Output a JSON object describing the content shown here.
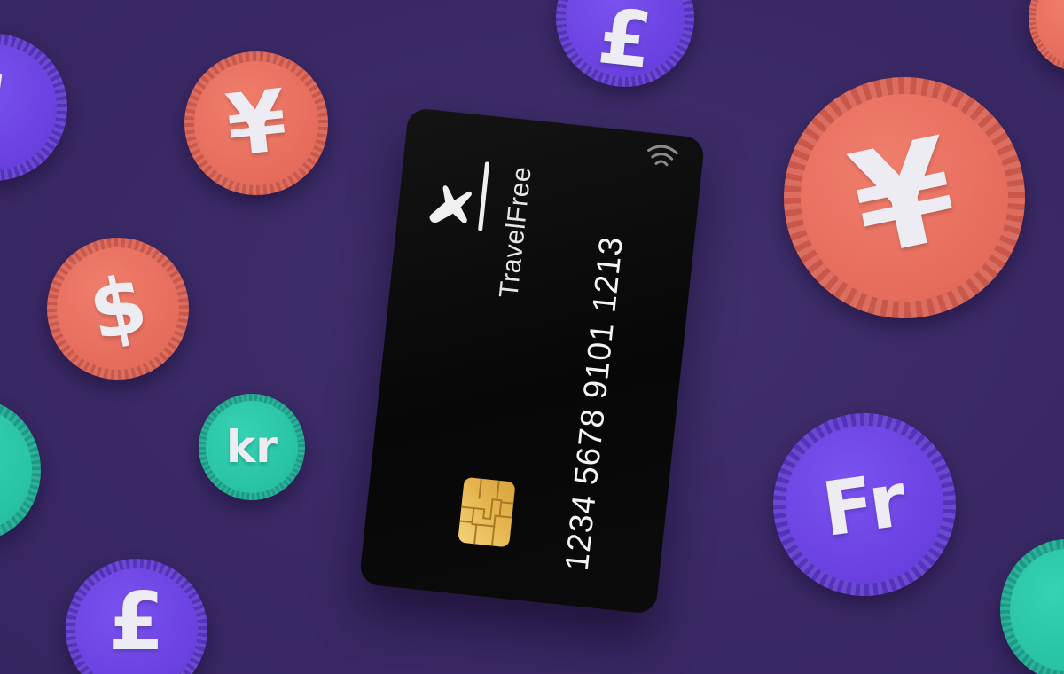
{
  "card": {
    "brand_name": "TravelFree",
    "number": "1234 5678 9101 1213"
  },
  "coins": [
    {
      "symbol": "£",
      "color": "purple"
    },
    {
      "symbol": "¥",
      "color": "salmon"
    },
    {
      "symbol": "£",
      "color": "purple"
    },
    {
      "symbol": "$",
      "color": "salmon"
    },
    {
      "symbol": "kr",
      "color": "teal"
    },
    {
      "symbol": "£",
      "color": "purple"
    },
    {
      "symbol": "¥",
      "color": "salmon"
    },
    {
      "symbol": "Fr",
      "color": "purple"
    }
  ],
  "colors": {
    "background": "#3b2a66",
    "salmon": "#e66c5c",
    "purple": "#6a41e0",
    "teal": "#27c3a4",
    "card": "#0b0b0b",
    "chip": "#e6b54f"
  },
  "icons": {
    "brand_logo": "airplane-slash-logo",
    "contactless": "contactless-icon",
    "chip": "emv-chip-icon"
  }
}
